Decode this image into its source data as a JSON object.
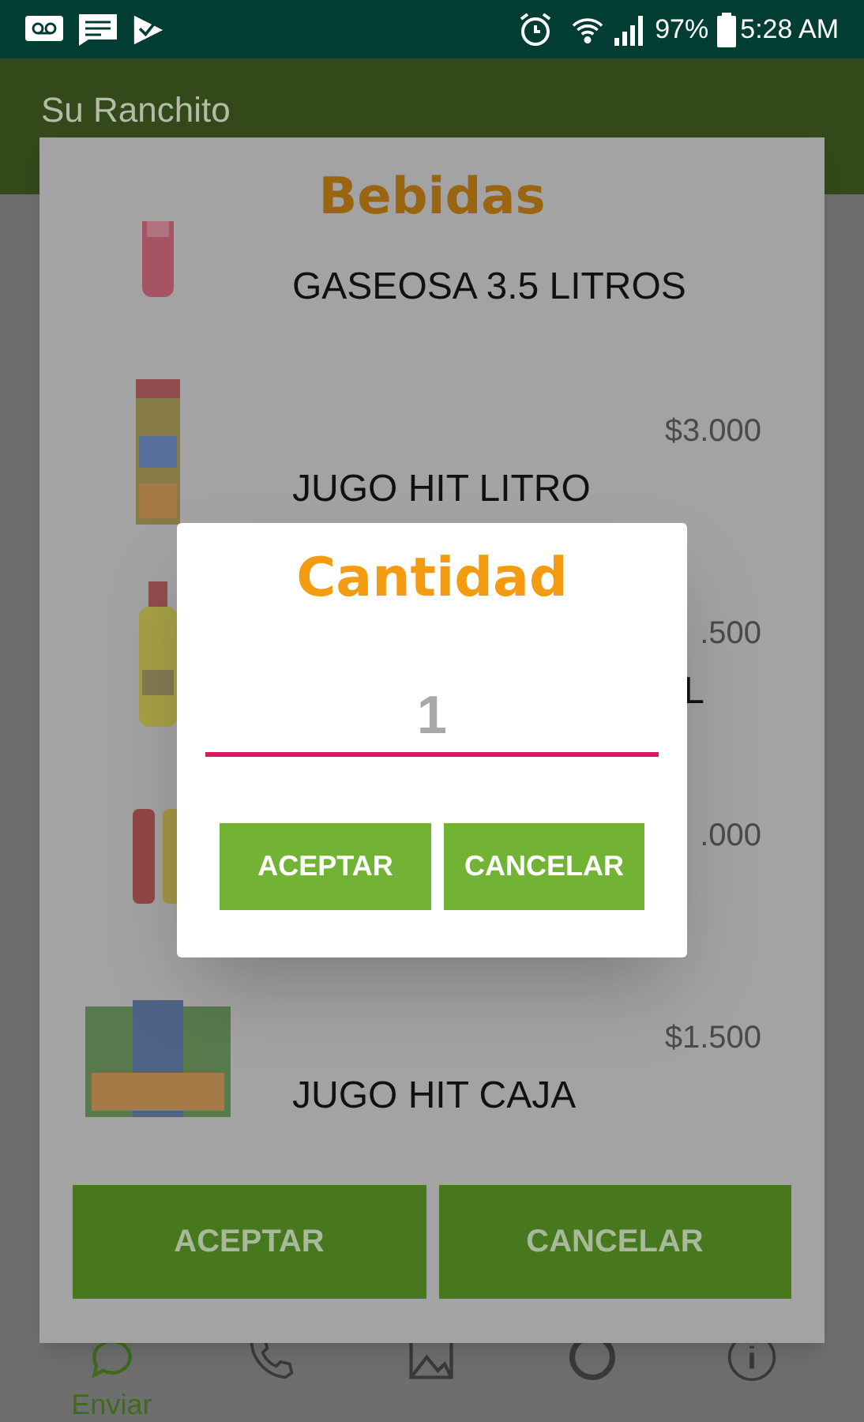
{
  "status_bar": {
    "battery": "97%",
    "time": "5:28 AM"
  },
  "app_bar": {
    "title": "Su Ranchito"
  },
  "bottom_nav": [
    {
      "label": "Enviar",
      "selected": true
    },
    {
      "selected": false
    },
    {
      "selected": false
    },
    {
      "selected": false
    },
    {
      "selected": false
    }
  ],
  "products_dialog": {
    "title": "Bebidas",
    "items": [
      {
        "name": "GASEOSA 3.5 LITROS",
        "cut": false
      },
      {
        "price": "$3.000",
        "name": "JUGO HIT LITRO",
        "cut": false
      },
      {
        "price": ".500",
        "name": "L",
        "cut": true
      },
      {
        "price": ".000"
      },
      {
        "price": "$1.500",
        "name": "JUGO HIT CAJA",
        "cut": false
      }
    ],
    "buttons": [
      "ACEPTAR",
      "CANCELAR"
    ]
  },
  "quantity_dialog": {
    "title": "Cantidad",
    "placeholder": "1",
    "buttons": [
      "ACEPTAR",
      "CANCELAR"
    ]
  }
}
